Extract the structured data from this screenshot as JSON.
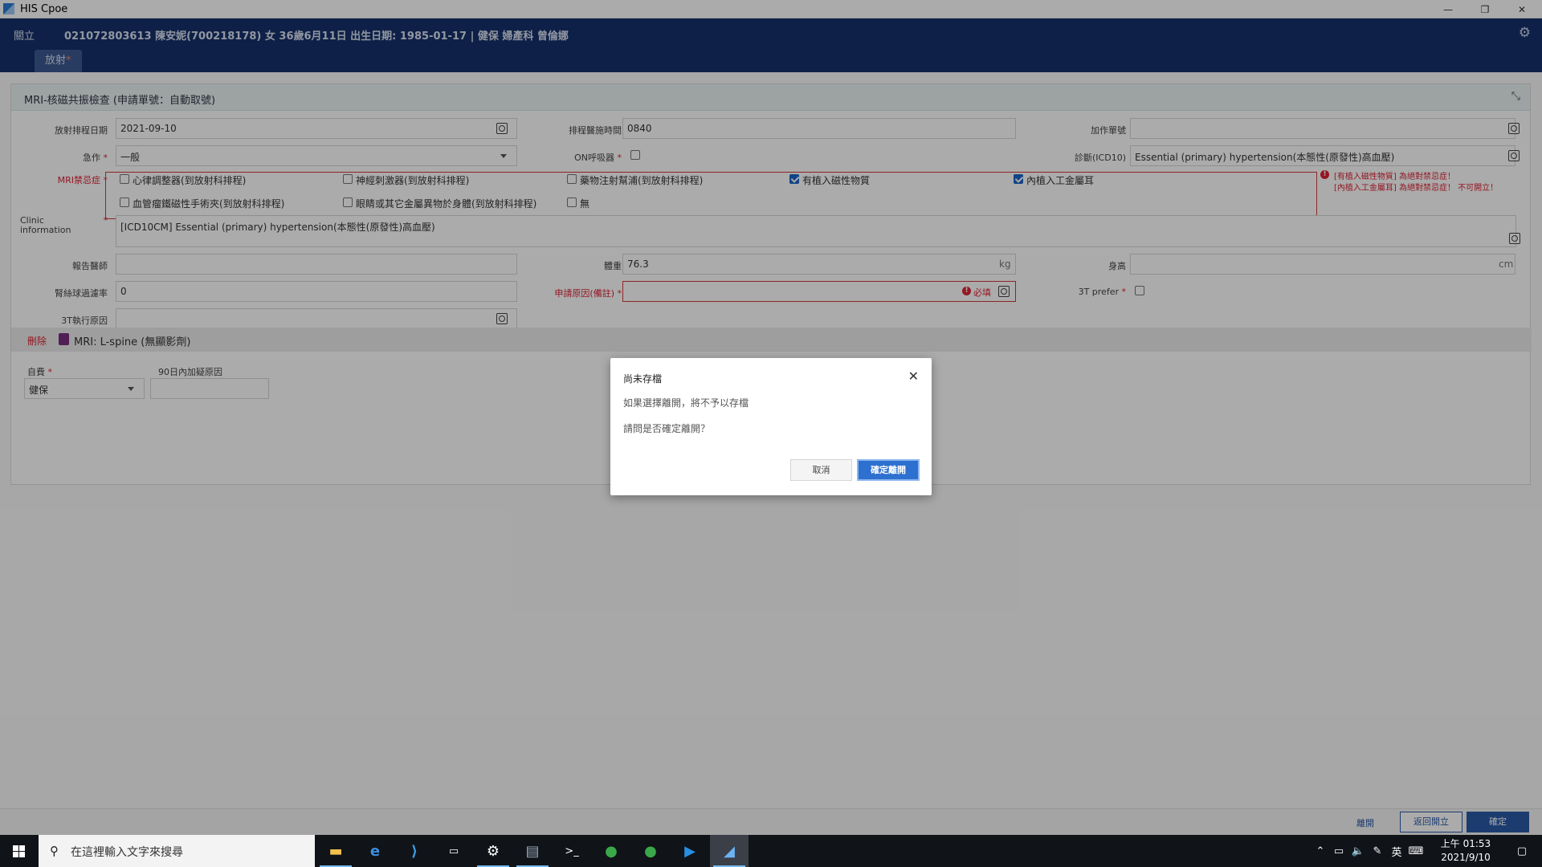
{
  "window": {
    "title": "HIS Cpoe",
    "minimize": "—",
    "restore": "❐",
    "close": "✕"
  },
  "header": {
    "dept": "關立",
    "patient_info": "021072803613 陳安妮(700218178) 女 36歲6月11日 出生日期: 1985-01-17 | 健保 婦產科 曾倫娜",
    "tab_label": "放射",
    "tab_star": "*"
  },
  "panel": {
    "title": "MRI-核磁共振檢查 (申請單號：自動取號)"
  },
  "form": {
    "exam_date": {
      "label": "放射排程日期",
      "value": "2021-09-10"
    },
    "exam_time": {
      "label": "排程醫施時間",
      "value": "0840"
    },
    "add_order": {
      "label": "加作單號",
      "value": ""
    },
    "urgency": {
      "label": "急作",
      "value": "一般"
    },
    "on_sedation": {
      "label": "ON呼吸器"
    },
    "diagnosis": {
      "label": "診斷(ICD10)",
      "value": "Essential (primary) hypertension(本態性(原發性)高血壓)"
    },
    "contraindication": {
      "label": "MRI禁忌症",
      "options": [
        {
          "label": "心律調整器(到放射科排程)",
          "checked": false
        },
        {
          "label": "神經刺激器(到放射科排程)",
          "checked": false
        },
        {
          "label": "藥物注射幫浦(到放射科排程)",
          "checked": false
        },
        {
          "label": "有植入磁性物質",
          "checked": true
        },
        {
          "label": "內植入工金屬耳",
          "checked": true
        },
        {
          "label": "血管瘤鐵磁性手術夾(到放射科排程)",
          "checked": false
        },
        {
          "label": "眼睛或其它金屬異物於身體(到放射科排程)",
          "checked": false
        },
        {
          "label": "無",
          "checked": false
        }
      ],
      "warning_line1": "[有植入磁性物質] 為絕對禁忌症！",
      "warning_line2": "[內植入工金屬耳] 為絕對禁忌症！ 不可開立！"
    },
    "clinic_info": {
      "label_line1": "Clinic",
      "label_line2": "information",
      "value": "[ICD10CM] Essential (primary) hypertension(本態性(原發性)高血壓)"
    },
    "report_doctor": {
      "label": "報告醫師",
      "value": ""
    },
    "weight": {
      "label": "體重",
      "value": "76.3",
      "unit": "kg"
    },
    "height": {
      "label": "身高",
      "value": "",
      "unit": "cm"
    },
    "renal_rate": {
      "label": "腎絲球過濾率",
      "value": "0"
    },
    "apply_reason": {
      "label": "申請原因(備註)",
      "required_text": "必填",
      "value": ""
    },
    "prefer_3t": {
      "label": "3T prefer"
    },
    "reason_3t": {
      "label": "3T執行原因",
      "value": ""
    }
  },
  "order": {
    "delete_label": "刪除",
    "name": "MRI: L-spine (無顯影劑)",
    "payer_label": "自費",
    "payer_value": "健保",
    "reason90_label": "90日內加疑原因",
    "reason90_value": ""
  },
  "dialog": {
    "title": "尚未存檔",
    "message1": "如果選擇離開，將不予以存檔",
    "message2": "請問是否確定離開？",
    "cancel_label": "取消",
    "confirm_label": "確定離開"
  },
  "bottom": {
    "btn1": "離開",
    "btn2": "返回開立",
    "btn3": "確定"
  },
  "taskbar": {
    "search_placeholder": "在這裡輸入文字來搜尋",
    "tray_ime": "英",
    "time": "上午 01:53",
    "date": "2021/9/10"
  },
  "colors": {
    "header_bg": "#16306a",
    "accent": "#2d70cf",
    "error": "#d23"
  }
}
